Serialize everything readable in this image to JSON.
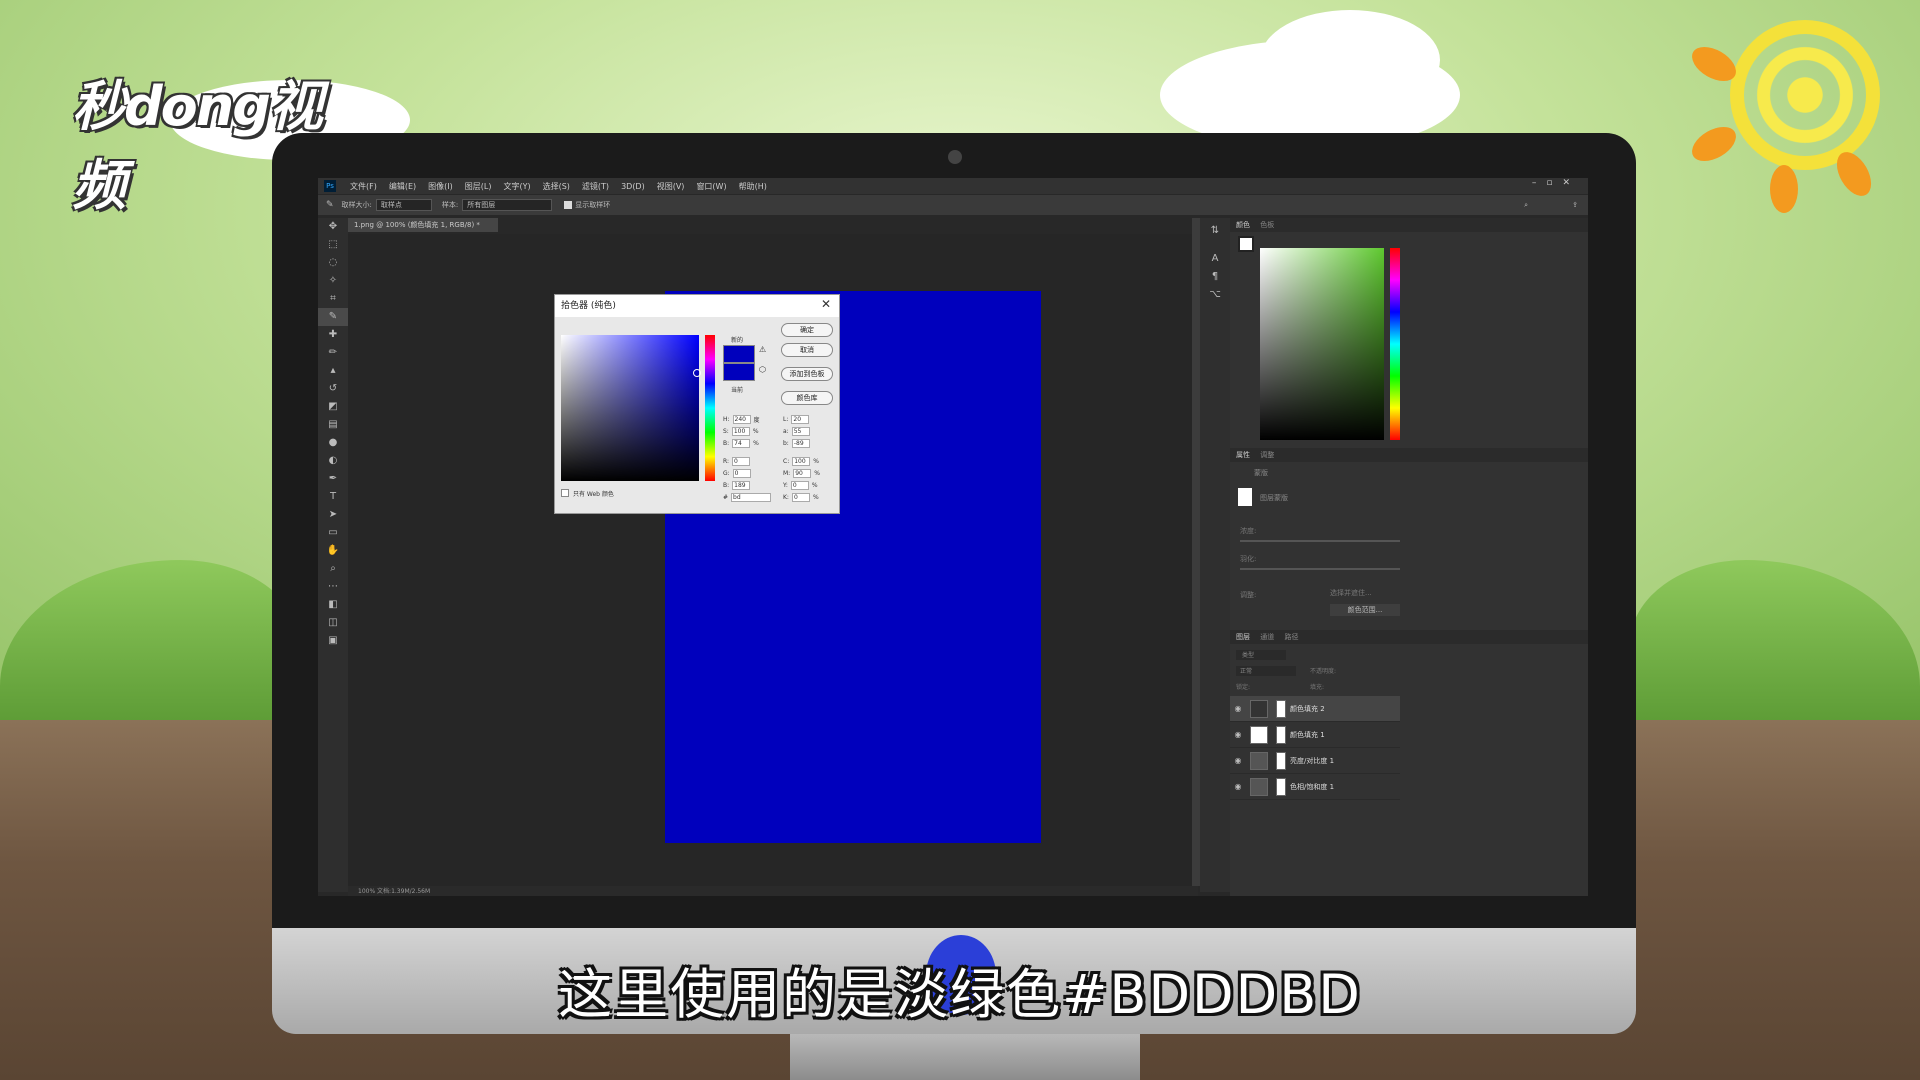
{
  "watermark": {
    "brand": "秒dong视频"
  },
  "caption": "这里使用的是淡绿色#BDDDBD",
  "ps": {
    "menu": [
      "文件(F)",
      "编辑(E)",
      "图像(I)",
      "图层(L)",
      "文字(Y)",
      "选择(S)",
      "滤镜(T)",
      "3D(D)",
      "视图(V)",
      "窗口(W)",
      "帮助(H)"
    ],
    "options": {
      "sample_size_label": "取样大小:",
      "sample_size": "取样点",
      "sample_label": "样本:",
      "sample": "所有图层",
      "show_ring": "显示取样环"
    },
    "tab": "1.png @ 100% (颜色填充 1, RGB/8) *",
    "status": "100%    文档:1.39M/2.56M",
    "panels": {
      "color_tabs": [
        "颜色",
        "色板"
      ],
      "props_tabs": [
        "属性",
        "调整"
      ],
      "mask_label": "蒙版",
      "pixel_mask": "图层蒙版",
      "density": "浓度:",
      "feather": "羽化:",
      "refine": "调整:",
      "select_subject": "选择并遮住...",
      "color_range": "颜色范围...",
      "layers_tabs": [
        "图层",
        "通道",
        "路径"
      ],
      "kind": "类型",
      "blend": "正常",
      "opacity": "不透明度:",
      "lock": "锁定:",
      "fill": "填充:",
      "layers": [
        "颜色填充 2",
        "颜色填充 1",
        "亮度/对比度 1",
        "色相/饱和度 1"
      ]
    },
    "picker": {
      "title": "拾色器 (纯色)",
      "new_label": "新的",
      "current_label": "当前",
      "ok": "确定",
      "cancel": "取消",
      "add_swatch": "添加到色板",
      "libraries": "颜色库",
      "web_only": "只有 Web 颜色",
      "hsb": [
        [
          "H:",
          "240",
          "度"
        ],
        [
          "S:",
          "100",
          "%"
        ],
        [
          "B:",
          "74",
          "%"
        ]
      ],
      "rgb": [
        [
          "R:",
          "0",
          ""
        ],
        [
          "G:",
          "0",
          ""
        ],
        [
          "B:",
          "189",
          ""
        ]
      ],
      "lab": [
        [
          "L:",
          "20",
          ""
        ],
        [
          "a:",
          "55",
          ""
        ],
        [
          "b:",
          "-89",
          ""
        ]
      ],
      "cmyk": [
        [
          "C:",
          "100",
          "%"
        ],
        [
          "M:",
          "90",
          "%"
        ],
        [
          "Y:",
          "0",
          "%"
        ],
        [
          "K:",
          "0",
          "%"
        ]
      ],
      "hex_label": "#",
      "hex": "bd",
      "new_color": "#0000bd",
      "current_color": "#0000bd"
    },
    "document_color": "#0000bd"
  }
}
